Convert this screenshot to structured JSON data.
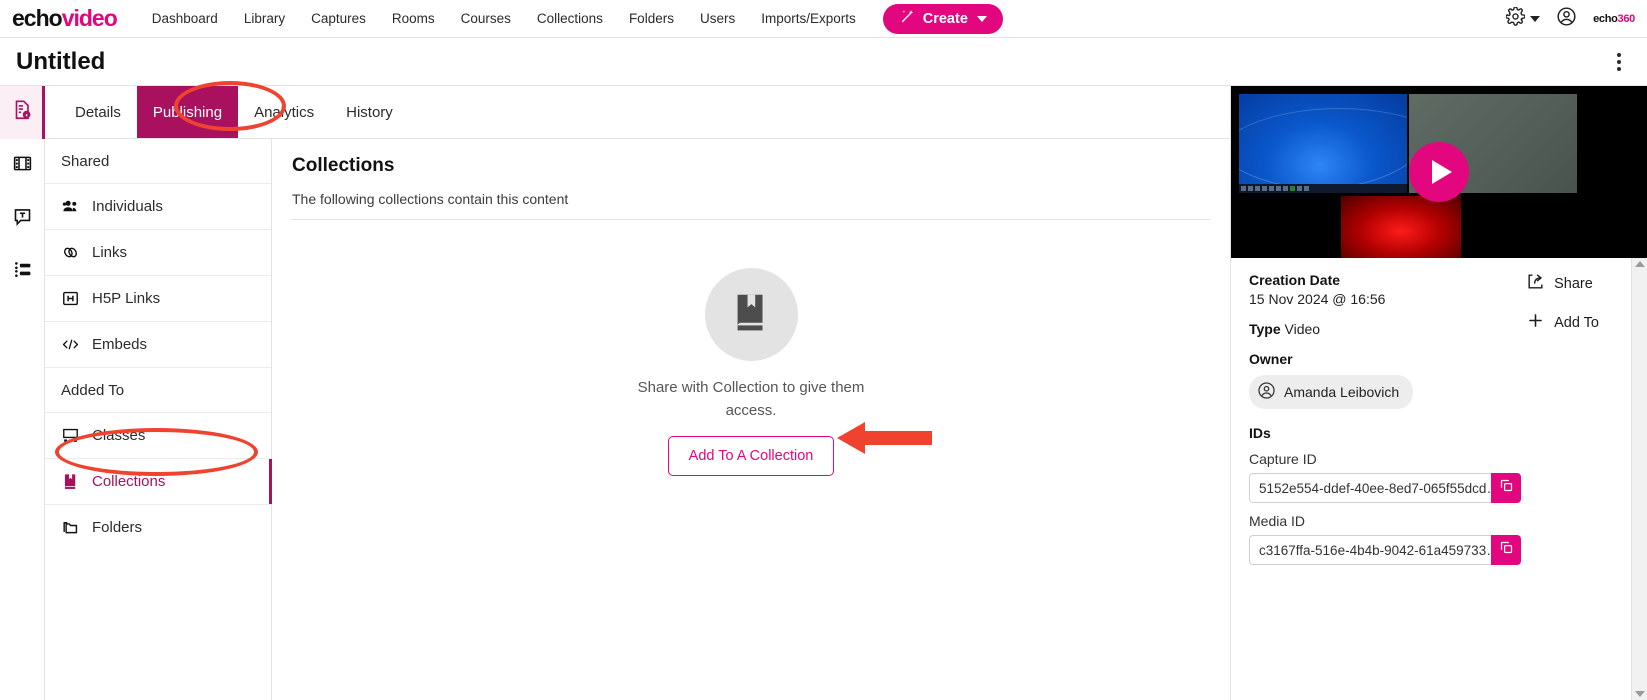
{
  "topnav": {
    "brand_echo": "echo",
    "brand_video": "video",
    "links": [
      {
        "label": "Dashboard"
      },
      {
        "label": "Library"
      },
      {
        "label": "Captures"
      },
      {
        "label": "Rooms"
      },
      {
        "label": "Courses"
      },
      {
        "label": "Collections"
      },
      {
        "label": "Folders"
      },
      {
        "label": "Users"
      },
      {
        "label": "Imports/Exports"
      }
    ],
    "create_label": "Create",
    "logo_right_a": "echo",
    "logo_right_b": "360",
    "gear_icon": "gear-icon",
    "account_icon": "account-circle-icon"
  },
  "titlebar": {
    "title": "Untitled",
    "kebab_icon": "more-vertical-icon"
  },
  "rail": [
    {
      "name": "details-info-icon",
      "active": true
    },
    {
      "name": "film-strip-icon",
      "active": false
    },
    {
      "name": "transcript-icon",
      "active": false
    },
    {
      "name": "list-settings-icon",
      "active": false
    }
  ],
  "tabs": [
    {
      "label": "Details",
      "selected": false
    },
    {
      "label": "Publishing",
      "selected": true
    },
    {
      "label": "Analytics",
      "selected": false
    },
    {
      "label": "History",
      "selected": false
    }
  ],
  "publishing_menu": [
    {
      "label": "Shared",
      "type": "group",
      "icon": ""
    },
    {
      "label": "Individuals",
      "type": "item",
      "icon": "people-icon",
      "active": false
    },
    {
      "label": "Links",
      "type": "item",
      "icon": "link-chain-icon",
      "active": false
    },
    {
      "label": "H5P Links",
      "type": "item",
      "icon": "h5p-icon",
      "active": false
    },
    {
      "label": "Embeds",
      "type": "item",
      "icon": "code-brackets-icon",
      "active": false
    },
    {
      "label": "Added To",
      "type": "group",
      "icon": ""
    },
    {
      "label": "Classes",
      "type": "item",
      "icon": "classes-icon",
      "active": false
    },
    {
      "label": "Collections",
      "type": "item",
      "icon": "book-bookmark-icon",
      "active": true
    },
    {
      "label": "Folders",
      "type": "item",
      "icon": "folders-icon",
      "active": false
    }
  ],
  "content": {
    "title": "Collections",
    "subtitle": "The following collections contain this content",
    "empty_icon": "book-bookmark-icon",
    "empty_text": "Share with Collection to give them access.",
    "add_button": "Add To A Collection",
    "arrow_annotation": "red-arrow-pointing-left"
  },
  "right_panel": {
    "thumbnail": {
      "play_icon": "play-button-icon"
    },
    "creation_date_label": "Creation Date",
    "creation_date_value": "15 Nov 2024 @ 16:56",
    "type_label": "Type",
    "type_value": "Video",
    "owner_label": "Owner",
    "owner_name": "Amanda Leibovich",
    "share_label": "Share",
    "add_to_label": "Add To",
    "ids_label": "IDs",
    "capture_id_label": "Capture ID",
    "capture_id_value": "5152e554-ddef-40ee-8ed7-065f55dcd…",
    "media_id_label": "Media ID",
    "media_id_value": "c3167ffa-516e-4b4b-9042-61a459733…",
    "copy_icon": "copy-icon",
    "share_icon": "share-arrow-icon",
    "add_icon": "plus-icon"
  },
  "colors": {
    "brand_pink": "#e2067f",
    "tab_selected": "#a9105e",
    "annotation_red": "#f0432f"
  }
}
